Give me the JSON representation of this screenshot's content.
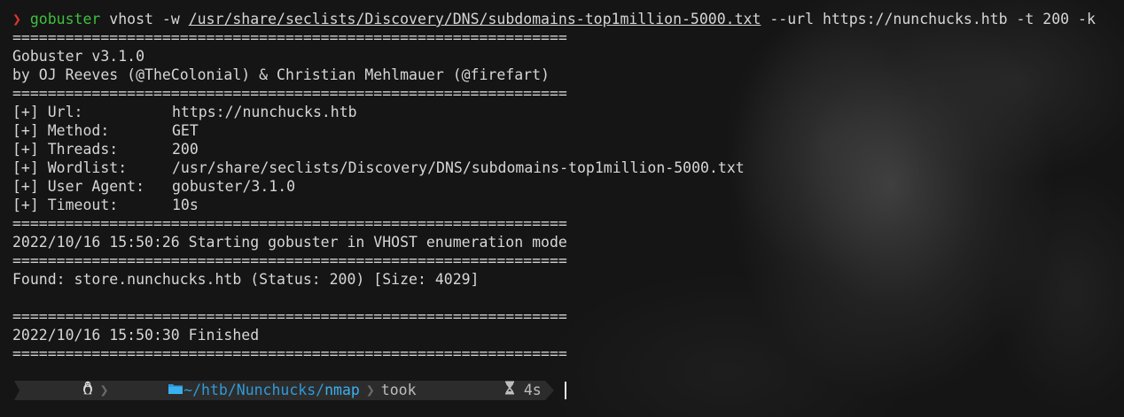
{
  "command": {
    "prompt_symbol": "❯",
    "program": "gobuster",
    "args_before": " vhost -w ",
    "wordlist_path": "/usr/share/seclists/Discovery/DNS/subdomains-top1million-5000.txt",
    "args_after": " --url https://nunchucks.htb -t 200 -k"
  },
  "separator": "===============================================================",
  "banner": {
    "version": "Gobuster v3.1.0",
    "authors": "by OJ Reeves (@TheColonial) & Christian Mehlmauer (@firefart)"
  },
  "options": [
    {
      "key": "[+] Url:",
      "value": "https://nunchucks.htb"
    },
    {
      "key": "[+] Method:",
      "value": "GET"
    },
    {
      "key": "[+] Threads:",
      "value": "200"
    },
    {
      "key": "[+] Wordlist:",
      "value": "/usr/share/seclists/Discovery/DNS/subdomains-top1million-5000.txt"
    },
    {
      "key": "[+] User Agent:",
      "value": "gobuster/3.1.0"
    },
    {
      "key": "[+] Timeout:",
      "value": "10s"
    }
  ],
  "start_message": "2022/10/16 15:50:26 Starting gobuster in VHOST enumeration mode",
  "found_message": "Found: store.nunchucks.htb (Status: 200) [Size: 4029]",
  "finish_message": "2022/10/16 15:50:30 Finished",
  "statusbar": {
    "os_icon": "linux-penguin-icon",
    "folder_icon": "folder-icon",
    "path_prefix": "~/htb/Nunchucks/",
    "path_current": "nmap",
    "took_label": "took",
    "hourglass_icon": "hourglass-icon",
    "took_value": "4s"
  },
  "colors": {
    "prompt_arrow": "#e0362f",
    "command_green": "#3fbf3f",
    "path_blue": "#2f9ad8",
    "segment_bg": "#2c2c2c"
  }
}
